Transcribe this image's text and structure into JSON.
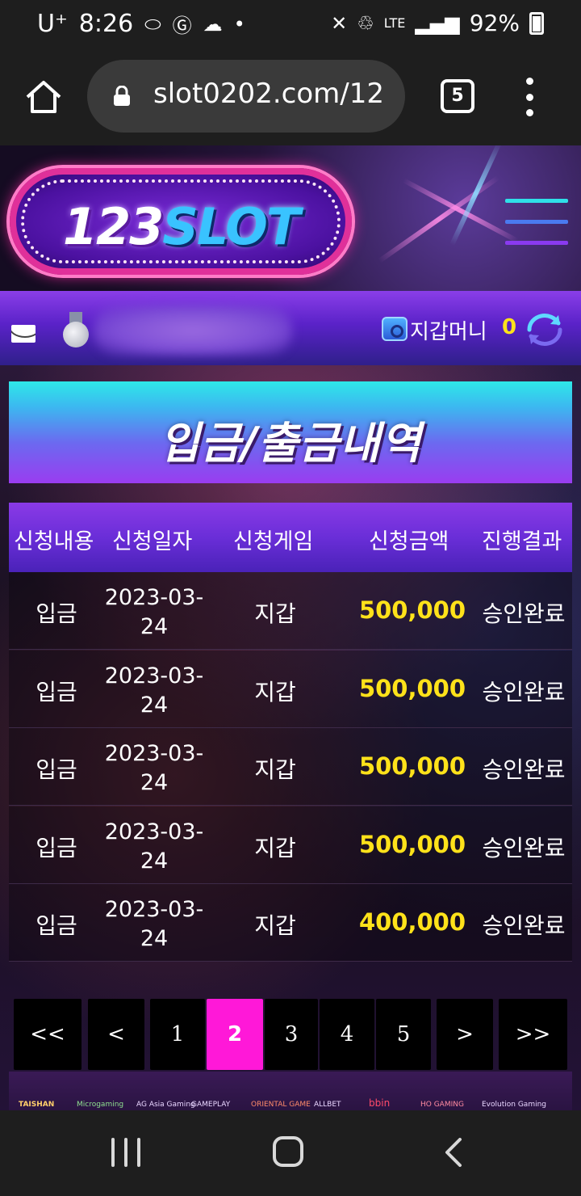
{
  "status_bar": {
    "carrier": "U⁺",
    "time": "8:26",
    "network": "LTE",
    "battery": "92%"
  },
  "browser": {
    "url": "slot0202.com/12",
    "tab_count": "5"
  },
  "site": {
    "logo_number": "123",
    "logo_word": "SLOT"
  },
  "user_bar": {
    "wallet_label": "지갑머니",
    "wallet_amount": "0"
  },
  "page": {
    "title": "입금/출금내역"
  },
  "table": {
    "headers": [
      "신청내용",
      "신청일자",
      "신청게임",
      "신청금액",
      "진행결과"
    ],
    "rows": [
      {
        "type": "입금",
        "date_line1": "2023-03-",
        "date_line2": "24",
        "game": "지갑",
        "amount": "500,000",
        "result": "승인완료"
      },
      {
        "type": "입금",
        "date_line1": "2023-03-",
        "date_line2": "24",
        "game": "지갑",
        "amount": "500,000",
        "result": "승인완료"
      },
      {
        "type": "입금",
        "date_line1": "2023-03-",
        "date_line2": "24",
        "game": "지갑",
        "amount": "500,000",
        "result": "승인완료"
      },
      {
        "type": "입금",
        "date_line1": "2023-03-",
        "date_line2": "24",
        "game": "지갑",
        "amount": "500,000",
        "result": "승인완료"
      },
      {
        "type": "입금",
        "date_line1": "2023-03-",
        "date_line2": "24",
        "game": "지갑",
        "amount": "400,000",
        "result": "승인완료"
      }
    ]
  },
  "pagination": {
    "first": "<<",
    "prev": "<",
    "pages": [
      "1",
      "2",
      "3",
      "4",
      "5"
    ],
    "current": "2",
    "next": ">",
    "last": ">>"
  },
  "partners": [
    "TAISHAN",
    "Microgaming",
    "AG Asia Gaming",
    "GAMEPLAY",
    "ORIENTAL GAME",
    "ALLBET",
    "bbin",
    "HO GAMING",
    "Evolution Gaming"
  ],
  "colors": {
    "accent_amount": "#ffe21a",
    "active_page": "#ff18d8"
  }
}
